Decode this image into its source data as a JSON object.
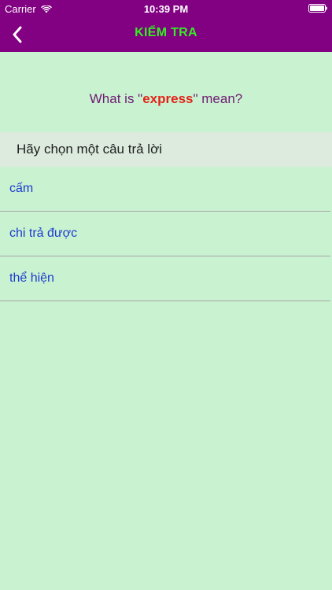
{
  "status_bar": {
    "carrier": "Carrier",
    "time": "10:39 PM",
    "wifi_icon": "wifi-icon",
    "battery_icon": "battery-full-icon"
  },
  "nav": {
    "back_icon": "chevron-left-icon",
    "title": "KIỂM TRA"
  },
  "question": {
    "prefix": "What is \"",
    "word": "express",
    "suffix": "\" mean?"
  },
  "section_header": "Hãy chọn một câu trả lời",
  "options": [
    {
      "label": "cấm"
    },
    {
      "label": "chi trả được"
    },
    {
      "label": "thể hiện"
    }
  ],
  "colors": {
    "header_bg": "#820082",
    "title": "#33ee22",
    "page_bg": "#c9f2d0",
    "question_text": "#6e1a73",
    "highlight_word": "#e2231a",
    "option_text": "#1f3bd1"
  }
}
